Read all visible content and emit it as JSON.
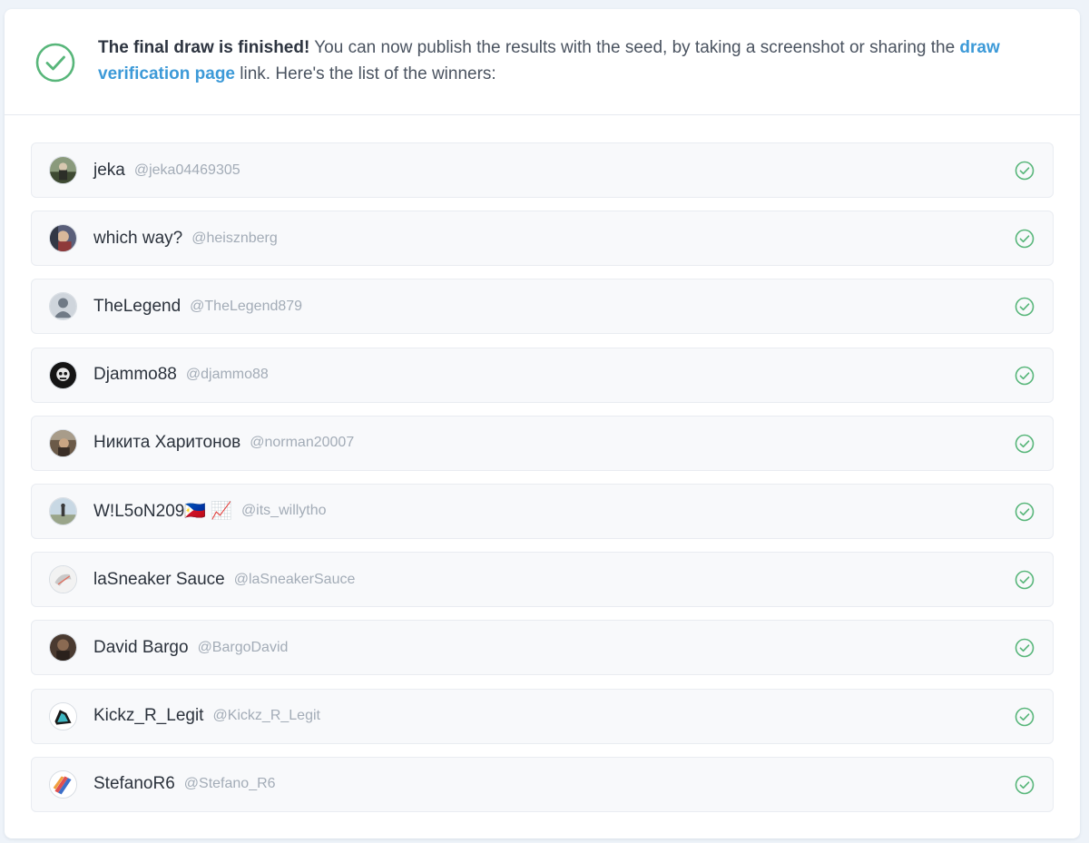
{
  "header": {
    "bold_text": "The final draw is finished!",
    "text_before_link": " You can now publish the results with the seed, by taking a screenshot or sharing the ",
    "link_text": "draw verification page",
    "text_after_link": " link. Here's the list of the winners:",
    "icon": "check-circle-icon"
  },
  "colors": {
    "accent_green": "#58b67a",
    "link_blue": "#3d9ad8"
  },
  "winners": [
    {
      "name": "jeka",
      "handle": "@jeka04469305"
    },
    {
      "name": "which way?",
      "handle": "@heisznberg"
    },
    {
      "name": "TheLegend",
      "handle": "@TheLegend879"
    },
    {
      "name": "Djammo88",
      "handle": "@djammo88"
    },
    {
      "name": "Никита Харитонов",
      "handle": "@norman20007"
    },
    {
      "name": "W!L5oN209🇵🇭 📈",
      "handle": "@its_willytho"
    },
    {
      "name": "laSneaker Sauce",
      "handle": "@laSneakerSauce"
    },
    {
      "name": "David Bargo",
      "handle": "@BargoDavid"
    },
    {
      "name": "Kickz_R_Legit",
      "handle": "@Kickz_R_Legit"
    },
    {
      "name": "StefanoR6",
      "handle": "@Stefano_R6"
    }
  ]
}
